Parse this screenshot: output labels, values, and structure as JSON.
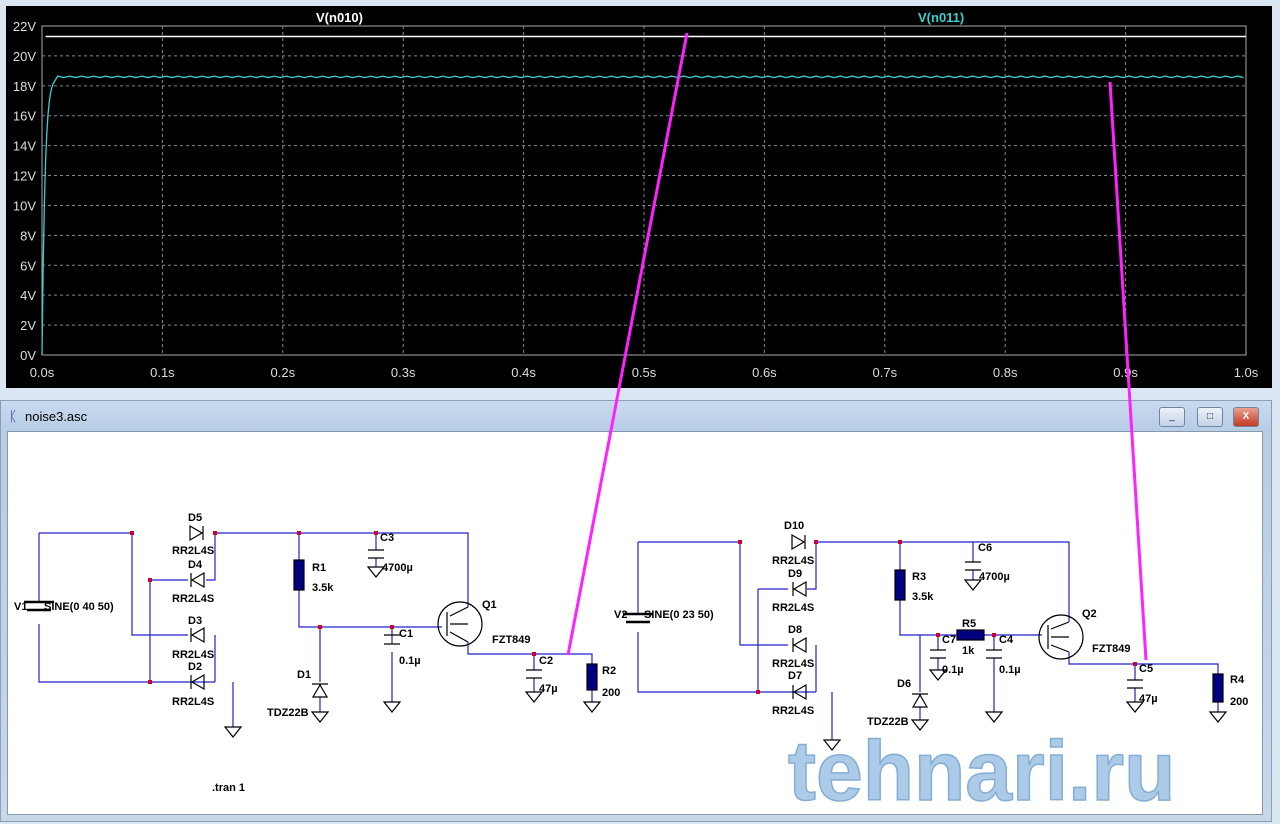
{
  "plot": {
    "traces": [
      {
        "name": "V(n010)",
        "color": "#ffffff",
        "level": 21.3
      },
      {
        "name": "V(n011)",
        "color": "#3ad0d0",
        "level": 18.6
      }
    ],
    "y_ticks": [
      "0V",
      "2V",
      "4V",
      "6V",
      "8V",
      "10V",
      "12V",
      "14V",
      "16V",
      "18V",
      "20V",
      "22V"
    ],
    "x_ticks": [
      "0.0s",
      "0.1s",
      "0.2s",
      "0.3s",
      "0.4s",
      "0.5s",
      "0.6s",
      "0.7s",
      "0.8s",
      "0.9s",
      "1.0s"
    ]
  },
  "schematic": {
    "title": "noise3.asc",
    "buttons": {
      "minimize": "_",
      "maximize": "□",
      "close": "X"
    },
    "left": {
      "V1": "V1",
      "V1v": "SINE(0 40 50)",
      "D5": "D5",
      "D4": "D4",
      "D3": "D3",
      "D2": "D2",
      "dmodel": "RR2L4S",
      "R1": "R1",
      "R1v": "3.5k",
      "C3": "C3",
      "C3v": "4700µ",
      "C1": "C1",
      "C1v": "0.1µ",
      "D1": "D1",
      "D1v": "TDZ22B",
      "Q1": "Q1",
      "Q1v": "FZT849",
      "C2": "C2",
      "C2v": "47µ",
      "R2": "R2",
      "R2v": "200",
      "tran": ".tran 1"
    },
    "right": {
      "V2": "V2",
      "V2v": "SINE(0 23 50)",
      "D10": "D10",
      "D9": "D9",
      "D8": "D8",
      "D7": "D7",
      "dmodel": "RR2L4S",
      "R3": "R3",
      "R3v": "3.5k",
      "C6": "C6",
      "C6v": "4700µ",
      "R5": "R5",
      "R5v": "1k",
      "C7": "C7",
      "C7v": "0.1µ",
      "C4": "C4",
      "C4v": "0.1µ",
      "D6": "D6",
      "D6v": "TDZ22B",
      "Q2": "Q2",
      "Q2v": "FZT849",
      "C5": "C5",
      "C5v": "47µ",
      "R4": "R4",
      "R4v": "200"
    }
  },
  "watermark": "tehnari.ru",
  "colors": {
    "wire": "#2222cc",
    "node": "#cc0033",
    "component": "#000080",
    "annotation": "#ff22ff"
  }
}
